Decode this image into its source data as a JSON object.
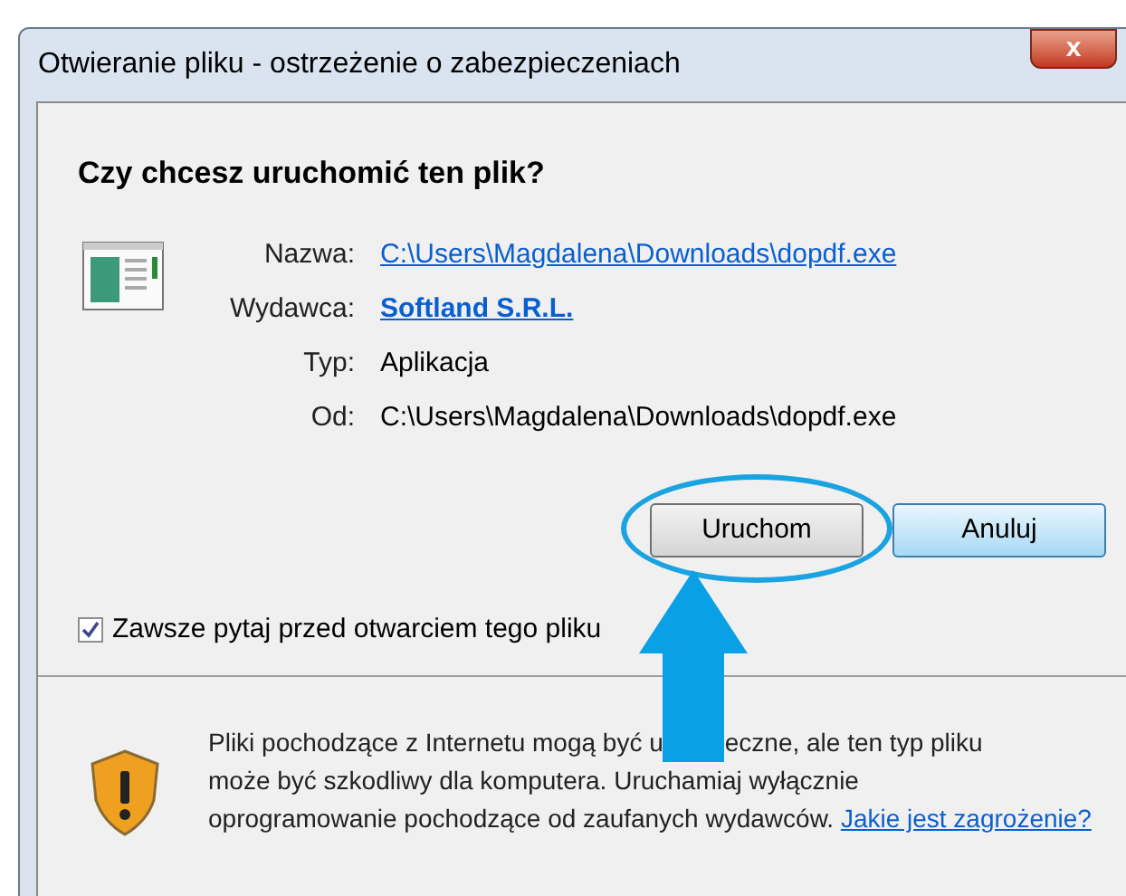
{
  "window": {
    "title": "Otwieranie pliku - ostrzeżenie o zabezpieczeniach",
    "close": "x"
  },
  "question": "Czy chcesz uruchomić ten plik?",
  "details": [
    {
      "label": "Nazwa:",
      "value": "C:\\Users\\Magdalena\\Downloads\\dopdf.exe",
      "kind": "link"
    },
    {
      "label": "Wydawca:",
      "value": "Softland S.R.L.",
      "kind": "bold-link"
    },
    {
      "label": "Typ:",
      "value": "Aplikacja",
      "kind": "text"
    },
    {
      "label": "Od:",
      "value": "C:\\Users\\Magdalena\\Downloads\\dopdf.exe",
      "kind": "text"
    }
  ],
  "buttons": [
    {
      "label": "Uruchom",
      "highlighted": true,
      "default": false
    },
    {
      "label": "Anuluj",
      "highlighted": false,
      "default": true
    }
  ],
  "always_ask": {
    "label": "Zawsze pytaj przed otwarciem tego pliku",
    "checked": true
  },
  "warning": {
    "line_1": [
      "Pliki pochodzące z Internetu mogą być u",
      "eczne, ale ten typ pliku"
    ],
    "line_2": "może być szkodliwy dla komputera. Uruchamiaj wyłącznie",
    "line_3": "oprogramowanie pochodzące od zaufanych wydawców.",
    "link": "Jakie jest zagrożenie?"
  }
}
